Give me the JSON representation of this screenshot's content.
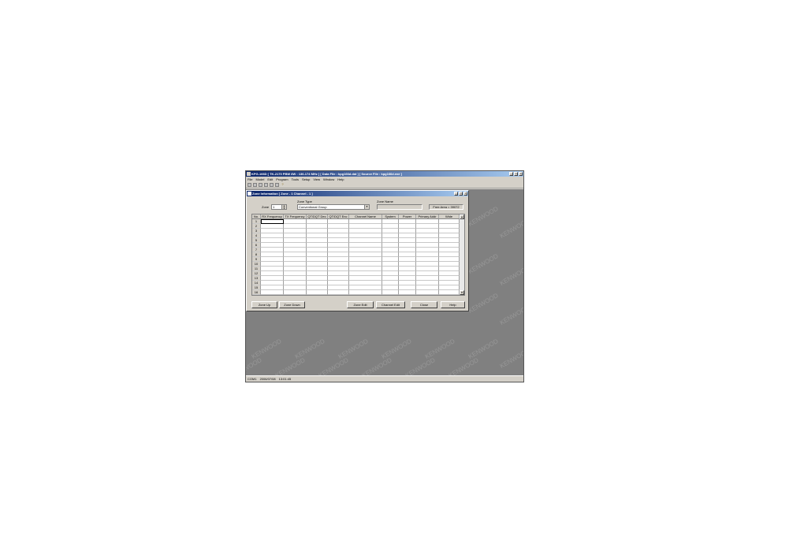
{
  "app": {
    "title": "KPG-166D [ TK-2170 PBW 8W : 136-174 MHz ] [ Data File : kpg166d.dat ] [ Source File : kpg166d.exe ]",
    "window_buttons": [
      "_",
      "□",
      "×"
    ],
    "menu": [
      "File",
      "Model",
      "Edit",
      "Program",
      "Tools",
      "Setup",
      "View",
      "Window",
      "Help"
    ],
    "toolbar_icons": [
      "new-icon",
      "open-icon",
      "save-icon",
      "print-icon",
      "read-icon",
      "write-icon",
      "help-icon"
    ],
    "watermark": "KENWOOD",
    "status": [
      "COM1",
      "2006/07/08",
      "13:01:45"
    ]
  },
  "dialog": {
    "title": "Zone Information [ Zone - 1 Channel - 1 ]",
    "zone_label": "Zone",
    "zone_value": "1",
    "zone_type_label": "Zone Type",
    "zone_type_value": "Conventional Group",
    "zone_name_label": "Zone Name",
    "zone_name_value": "",
    "free_area": "Free Area = 39072",
    "columns": [
      "No.",
      "RX Frequency",
      "TX Frequency",
      "QT/DQT Dec",
      "QT/DQT Enc",
      "Channel Name",
      "System",
      "Power",
      "Primary Addr",
      "Wide"
    ],
    "rows": [
      "1",
      "2",
      "3",
      "4",
      "5",
      "6",
      "7",
      "8",
      "9",
      "10",
      "11",
      "12",
      "13",
      "14",
      "15",
      "16"
    ],
    "buttons": {
      "zone_up": "Zone Up",
      "zone_down": "Zone Down",
      "zone_edit": "Zone Edit",
      "channel_edit": "Channel Edit",
      "close": "Close",
      "help": "Help"
    }
  },
  "colors": {
    "titlebar_start": "#0a246a",
    "titlebar_end": "#a6caf0",
    "workspace": "#808080",
    "face": "#d4d0c8"
  }
}
